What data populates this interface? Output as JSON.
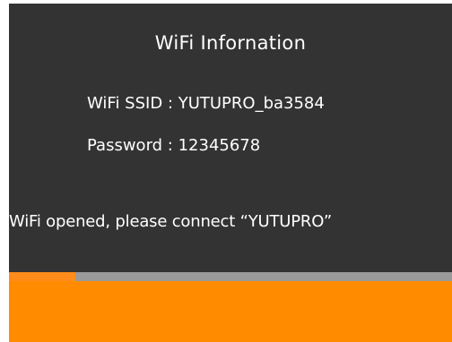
{
  "dialog": {
    "title": "WiFi Infornation",
    "ssid_label": "WiFi  SSID : ",
    "ssid_value": "YUTUPRO_ba3584",
    "password_label": "Password : ",
    "password_value": "12345678",
    "status_message": "WiFi opened, please connect  “YUTUPRO”"
  },
  "progress": {
    "fraction": 0.15
  },
  "colors": {
    "panel_background": "#333333",
    "text": "#ffffff",
    "accent": "#ff8c00",
    "track": "#9a9a9a"
  }
}
